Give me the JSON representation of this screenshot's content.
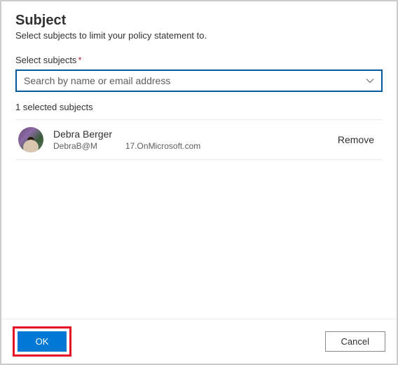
{
  "header": {
    "title": "Subject",
    "subtitle": "Select subjects to limit your policy statement to."
  },
  "search": {
    "label": "Select subjects",
    "required_marker": "*",
    "placeholder": "Search by name or email address"
  },
  "selected": {
    "count_text": "1 selected subjects",
    "items": [
      {
        "name": "Debra Berger",
        "email_part1": "DebraB@M",
        "email_part2": "17.OnMicrosoft.com",
        "remove_label": "Remove"
      }
    ]
  },
  "footer": {
    "ok_label": "OK",
    "cancel_label": "Cancel"
  }
}
